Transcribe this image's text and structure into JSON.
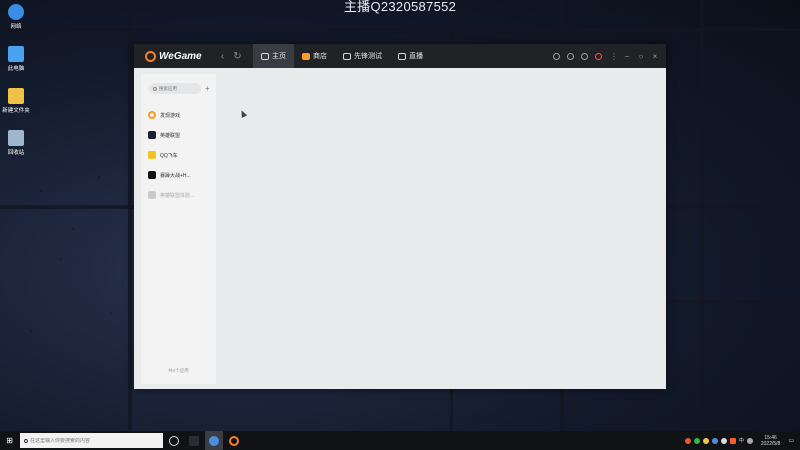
{
  "watermark": "主播Q2320587552",
  "desktop_icons": [
    {
      "label": "网络",
      "icon": "network-icon",
      "color": "#3a8ee6"
    },
    {
      "label": "此电脑",
      "icon": "computer-icon",
      "color": "#4aa3f0"
    },
    {
      "label": "新建文件夹",
      "icon": "folder-icon",
      "color": "#f0c24a"
    },
    {
      "label": "回收站",
      "icon": "recycle-bin-icon",
      "color": "#9fb6cf"
    }
  ],
  "window": {
    "logo": "WeGame",
    "tabs": [
      {
        "label": "主页",
        "icon": "home-icon",
        "active": true
      },
      {
        "label": "商店",
        "icon": "store-icon",
        "active": false
      },
      {
        "label": "先锋测试",
        "icon": "test-icon",
        "active": false
      },
      {
        "label": "直播",
        "icon": "live-icon",
        "active": false
      }
    ]
  },
  "sidebar": {
    "search_placeholder": "搜索应用",
    "add_label": "+",
    "games": [
      {
        "label": "发现游戏",
        "color": "#ff9a1f",
        "disabled": false
      },
      {
        "label": "英雄联盟",
        "color": "#1d2230",
        "disabled": false
      },
      {
        "label": "QQ飞车",
        "color": "#f2c21d",
        "disabled": false
      },
      {
        "label": "暴躁大战+H...",
        "color": "#111111",
        "disabled": false
      },
      {
        "label": "英雄联盟体验...",
        "color": "#c9c9c9",
        "disabled": true
      }
    ],
    "footer": "共4个应用"
  },
  "taskbar": {
    "search_placeholder": "在这里输入你要搜索的内容",
    "time": "15:46",
    "date": "2022/5/8",
    "ime": "中"
  },
  "colors": {
    "accent": "#ff7e1a",
    "titlebar": "#202226",
    "content_bg": "#e9eaec"
  }
}
